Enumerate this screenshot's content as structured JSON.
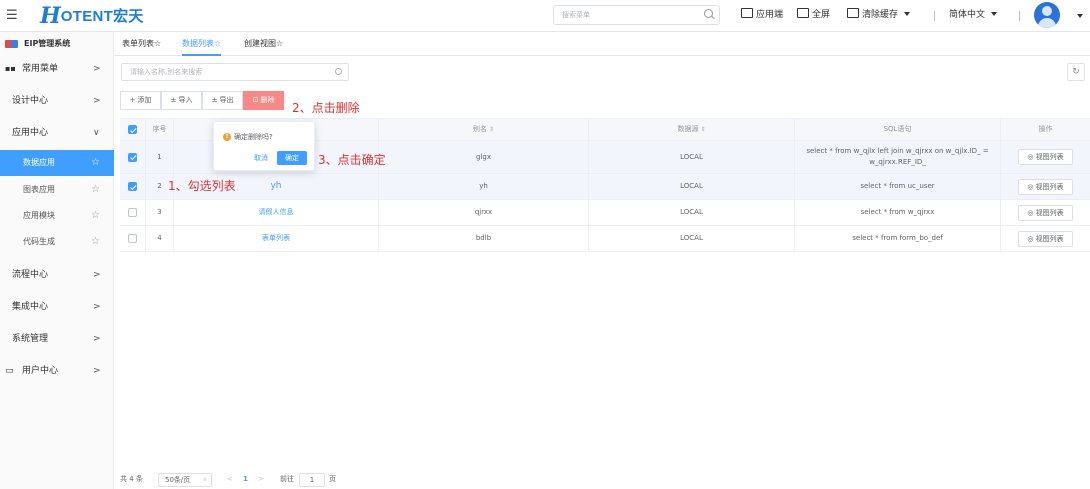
{
  "header": {
    "logo_mark": "H",
    "logo_text": "OTENT宏天",
    "search_placeholder": "搜索菜单",
    "app_end": "应用端",
    "fullscreen": "全屏",
    "clear_cache": "清除缓存",
    "language": "简体中文",
    "colors": {
      "brand": "#1c7dd6"
    }
  },
  "sidebar": {
    "title": "EIP管理系统",
    "menus": [
      {
        "label": "常用菜单",
        "icon": "grid-icon",
        "expanded": false
      },
      {
        "label": "设计中心",
        "expanded": false
      },
      {
        "label": "应用中心",
        "expanded": true
      },
      {
        "label": "流程中心",
        "expanded": false
      },
      {
        "label": "集成中心",
        "expanded": false
      },
      {
        "label": "系统管理",
        "expanded": false
      },
      {
        "label": "用户中心",
        "icon": "monitor-icon",
        "expanded": false
      }
    ],
    "app_children": [
      {
        "label": "数据应用",
        "active": true
      },
      {
        "label": "图表应用",
        "active": false
      },
      {
        "label": "应用模块",
        "active": false
      },
      {
        "label": "代码生成",
        "active": false
      }
    ]
  },
  "tabs": [
    {
      "label": "表单列表☆",
      "active": false
    },
    {
      "label": "数据列表☆",
      "active": true
    },
    {
      "label": "创建视图☆",
      "active": false
    }
  ],
  "filter": {
    "placeholder": "请输入名称,别名来搜索"
  },
  "toolbar": {
    "add": "+ 添加",
    "import": "± 导入",
    "export": "± 导出",
    "delete": "删除"
  },
  "table": {
    "headers": {
      "index": "序号",
      "alias": "别名",
      "datasource": "数据源",
      "sql": "SQL语句",
      "action": "操作"
    },
    "rows": [
      {
        "index": "1",
        "name": "",
        "alias": "glgx",
        "datasource": "LOCAL",
        "sql": "select * from w_qjlx left join w_qjrxx on w_qjlx.ID_ = w_qjrxx.REF_ID_",
        "action": "视图列表",
        "checked": true
      },
      {
        "index": "2",
        "name": "yh",
        "alias": "yh",
        "datasource": "LOCAL",
        "sql": "select * from uc_user",
        "action": "视图列表",
        "checked": true
      },
      {
        "index": "3",
        "name": "请假人信息",
        "alias": "qjrxx",
        "datasource": "LOCAL",
        "sql": "select * from w_qjrxx",
        "action": "视图列表",
        "checked": false
      },
      {
        "index": "4",
        "name": "表单列表",
        "alias": "bdlb",
        "datasource": "LOCAL",
        "sql": "select * from form_bo_def",
        "action": "视图列表",
        "checked": false
      }
    ]
  },
  "popover": {
    "message": "确定删除吗?",
    "cancel": "取消",
    "confirm": "确定"
  },
  "annotations": {
    "step1": "1、勾选列表",
    "step2": "2、点击删除",
    "step3": "3、点击确定",
    "color": "#e03131"
  },
  "pager": {
    "total": "共 4 条",
    "page_size": "50条/页",
    "prev": "<",
    "current": "1",
    "next": ">",
    "goto": "前往",
    "goto_value": "1",
    "page_unit": "页"
  }
}
